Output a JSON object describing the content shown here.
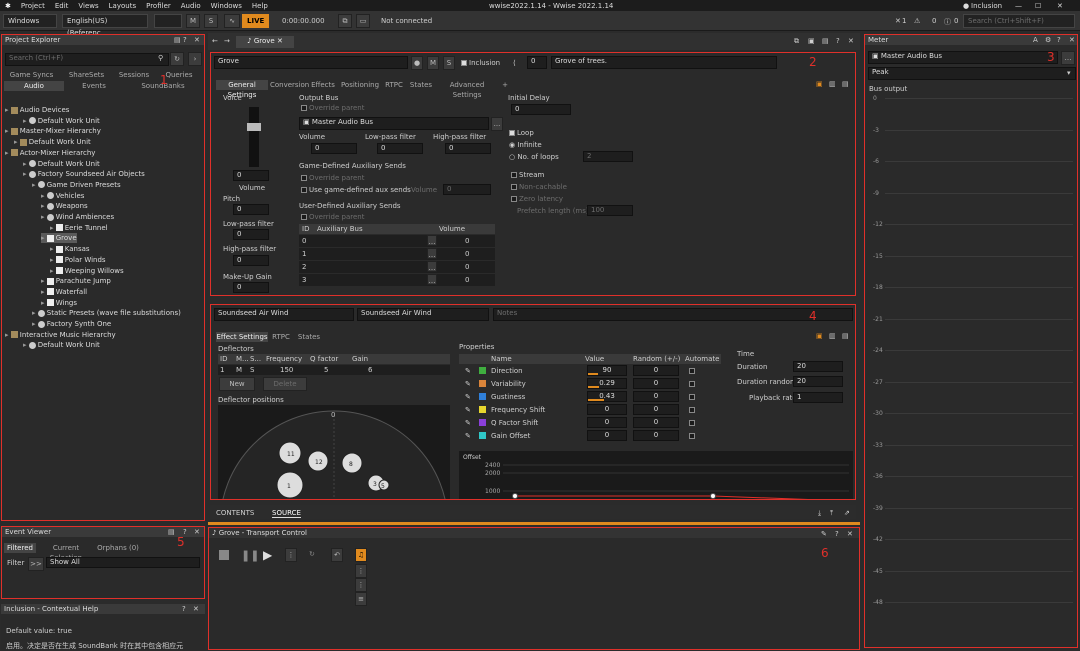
{
  "app": {
    "title": "wwise2022.1.14 - Wwise 2022.1.14",
    "user": "Inclusion"
  },
  "menu": [
    "Project",
    "Edit",
    "Views",
    "Layouts",
    "Profiler",
    "Audio",
    "Windows",
    "Help"
  ],
  "toolbar": {
    "layout": "Windows",
    "language": "English(US) (Referenc...",
    "m": "M",
    "s": "S",
    "live": "LIVE",
    "time": "0:00:00.000",
    "connection": "Not connected",
    "x_count": "1",
    "count_a": "0",
    "count_b": "0",
    "search_placeholder": "Search (Ctrl+Shift+F)"
  },
  "project_explorer": {
    "title": "Project Explorer",
    "search_placeholder": "Search (Ctrl+F)",
    "tabs_row1": [
      "Game Syncs",
      "ShareSets",
      "Sessions",
      "Queries"
    ],
    "tabs_row2": [
      "Audio",
      "Events",
      "SoundBanks"
    ],
    "active_tab": "Audio",
    "tree": [
      {
        "label": "Audio Devices",
        "indent": 0
      },
      {
        "label": "Default Work Unit",
        "indent": 2
      },
      {
        "label": "Master-Mixer Hierarchy",
        "indent": 0
      },
      {
        "label": "Default Work Unit",
        "indent": 1
      },
      {
        "label": "Actor-Mixer Hierarchy",
        "indent": 0
      },
      {
        "label": "Default Work Unit",
        "indent": 2
      },
      {
        "label": "Factory Soundseed Air Objects",
        "indent": 2
      },
      {
        "label": "Game Driven Presets",
        "indent": 3
      },
      {
        "label": "Vehicles",
        "indent": 4
      },
      {
        "label": "Weapons",
        "indent": 4
      },
      {
        "label": "Wind Ambiences",
        "indent": 4
      },
      {
        "label": "Eerie Tunnel",
        "indent": 5
      },
      {
        "label": "Grove",
        "indent": 4,
        "selected": true
      },
      {
        "label": "Kansas",
        "indent": 5
      },
      {
        "label": "Polar Winds",
        "indent": 5
      },
      {
        "label": "Weeping Willows",
        "indent": 5
      },
      {
        "label": "Parachute Jump",
        "indent": 4
      },
      {
        "label": "Waterfall",
        "indent": 4
      },
      {
        "label": "Wings",
        "indent": 4
      },
      {
        "label": "Static Presets (wave file substitutions)",
        "indent": 3
      },
      {
        "label": "Factory Synth One",
        "indent": 3
      },
      {
        "label": "Interactive Music Hierarchy",
        "indent": 0
      },
      {
        "label": "Default Work Unit",
        "indent": 2
      }
    ]
  },
  "event_viewer": {
    "title": "Event Viewer",
    "tabs": [
      "Filtered",
      "Current Selection",
      "Orphans (0)"
    ],
    "filter_label": "Filter",
    "filter_btn": ">>",
    "filter_value": "Show All"
  },
  "help": {
    "title": "Inclusion - Contextual Help",
    "line1": "Default value: true",
    "line2": "启用。决定是否在生成 SoundBank 时在其中包含相应元"
  },
  "editor": {
    "tab": "Grove",
    "name": "Grove",
    "inclusion_label": "Inclusion",
    "ref_count": "0",
    "notes": "Grove of trees.",
    "tabs": [
      "General Settings",
      "Conversion",
      "Effects",
      "Positioning",
      "RTPC",
      "States",
      "Advanced Settings",
      "+"
    ],
    "voice": {
      "title": "Voice",
      "volume_value": "0",
      "volume_label": "Volume",
      "pitch_label": "Pitch",
      "pitch_value": "0",
      "lpf_label": "Low-pass filter",
      "lpf_value": "0",
      "hpf_label": "High-pass filter",
      "hpf_value": "0",
      "makeup_label": "Make-Up Gain",
      "makeup_value": "0"
    },
    "output_bus": {
      "title": "Output Bus",
      "override": "Override parent",
      "bus": "Master Audio Bus",
      "more": "...",
      "vol_label": "Volume",
      "vol_value": "0",
      "lpf_label": "Low-pass filter",
      "lpf_value": "0",
      "hpf_label": "High-pass filter",
      "hpf_value": "0"
    },
    "game_aux": {
      "title": "Game-Defined Auxiliary Sends",
      "override": "Override parent",
      "use": "Use game-defined aux sends",
      "volume": "Volume",
      "volume_value": "0"
    },
    "user_aux": {
      "title": "User-Defined Auxiliary Sends",
      "override": "Override parent",
      "col_id": "ID",
      "col_bus": "Auxiliary Bus",
      "col_vol": "Volume",
      "rows": [
        {
          "id": "0",
          "vol": "0"
        },
        {
          "id": "1",
          "vol": "0"
        },
        {
          "id": "2",
          "vol": "0"
        },
        {
          "id": "3",
          "vol": "0"
        }
      ]
    },
    "initial_delay": {
      "title": "Initial Delay",
      "value": "0"
    },
    "loop": {
      "label": "Loop",
      "infinite": "Infinite",
      "no_of_loops": "No. of loops",
      "loops_value": "2"
    },
    "stream": {
      "label": "Stream",
      "non_cachable": "Non-cachable",
      "zero_latency": "Zero latency",
      "prefetch": "Prefetch length (ms)",
      "prefetch_value": "100"
    }
  },
  "source": {
    "name1": "Soundseed Air Wind",
    "name2": "Soundseed Air Wind",
    "notes": "Notes",
    "tabs": [
      "Effect Settings",
      "RTPC",
      "States"
    ],
    "deflectors": {
      "title": "Deflectors",
      "cols": [
        "ID",
        "M...",
        "S...",
        "Frequency",
        "Q factor",
        "Gain"
      ],
      "row": {
        "id": "1",
        "m": "M",
        "s": "S",
        "freq": "150",
        "q": "5",
        "gain": "6"
      },
      "new_btn": "New",
      "delete_btn": "Delete",
      "positions_title": "Deflector positions",
      "axis_zero": "0",
      "points": [
        "11",
        "12",
        "8",
        "3",
        "5",
        "1"
      ]
    },
    "properties": {
      "title": "Properties",
      "cols": [
        "Name",
        "Value",
        "Random (+/-)",
        "Automate"
      ],
      "rows": [
        {
          "name": "Direction",
          "value": "90",
          "random": "0",
          "color": "#3fae3f",
          "fill": 0.25
        },
        {
          "name": "Variability",
          "value": "0.29",
          "random": "0",
          "color": "#d9843a",
          "fill": 0.29
        },
        {
          "name": "Gustiness",
          "value": "0.43",
          "random": "0",
          "color": "#2f7fd9",
          "fill": 0.43
        },
        {
          "name": "Frequency Shift",
          "value": "0",
          "random": "0",
          "color": "#e6d62e",
          "fill": 0
        },
        {
          "name": "Q Factor Shift",
          "value": "0",
          "random": "0",
          "color": "#8a3fd9",
          "fill": 0
        },
        {
          "name": "Gain Offset",
          "value": "0",
          "random": "0",
          "color": "#2fc7c7",
          "fill": 0
        }
      ]
    },
    "time": {
      "title": "Time",
      "duration_label": "Duration",
      "duration": "20",
      "dur_random_label": "Duration random",
      "dur_random": "20",
      "rate_label": "Playback rate",
      "rate": "1"
    },
    "graph": {
      "title": "Offset",
      "y": [
        "2400",
        "2000",
        "1000"
      ]
    },
    "bottom_tabs": [
      "CONTENTS",
      "SOURCE"
    ]
  },
  "transport": {
    "title": "Grove - Transport Control"
  },
  "meter": {
    "title": "Meter",
    "bus": "Master Audio Bus",
    "mode": "Peak",
    "output": "Bus output",
    "ticks": [
      "0",
      "-3",
      "-6",
      "-9",
      "-12",
      "-15",
      "-18",
      "-21",
      "-24",
      "-27",
      "-30",
      "-33",
      "-36",
      "-39",
      "-42",
      "-45",
      "-48"
    ]
  },
  "markers": {
    "n1": "1",
    "n2": "2",
    "n3": "3",
    "n4": "4",
    "n5": "5",
    "n6": "6"
  }
}
